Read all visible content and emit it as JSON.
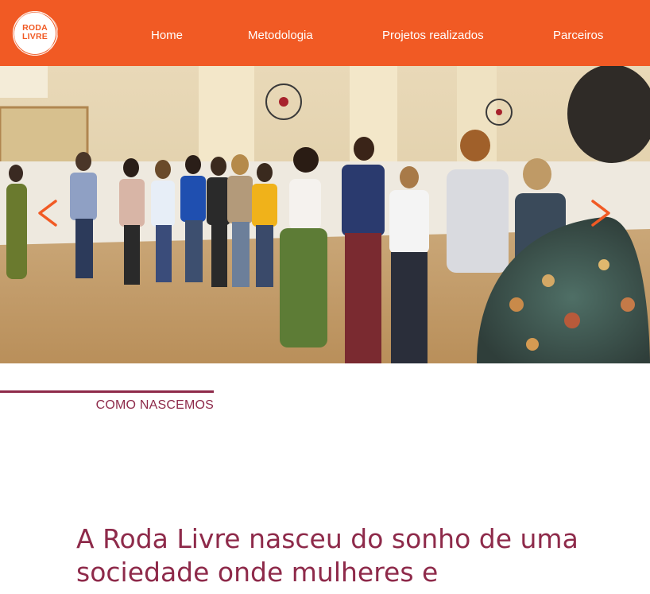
{
  "brand": {
    "logo_line1": "RODA",
    "logo_line2": "LIVRE",
    "accent_color": "#f15a24",
    "text_color": "#8e2a4a"
  },
  "nav": {
    "items": [
      {
        "label": "Home"
      },
      {
        "label": "Metodologia"
      },
      {
        "label": "Projetos realizados"
      },
      {
        "label": "Parceiros"
      }
    ]
  },
  "carousel": {
    "prev_icon": "chevron-left-icon",
    "next_icon": "chevron-right-icon",
    "image_subject": "group-photo"
  },
  "section": {
    "label": "COMO NASCEMOS",
    "headline": "A Roda Livre nasceu do sonho de uma sociedade onde mulheres e"
  }
}
